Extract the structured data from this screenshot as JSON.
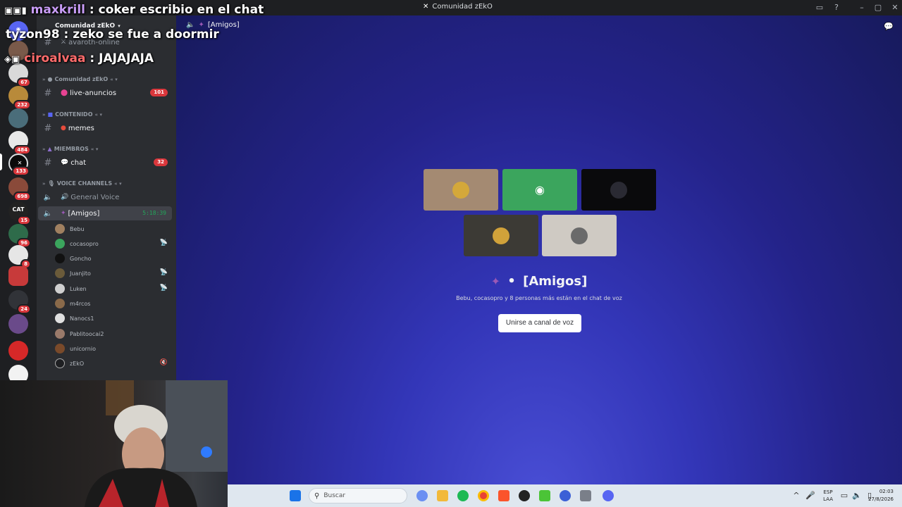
{
  "window": {
    "title": "Comunidad zEkO"
  },
  "overlay_chat": [
    {
      "user": "maxkrill",
      "message": "coker escribio en el chat",
      "color": "#c89cf6"
    },
    {
      "user": "tyzon98",
      "message": "zeko se fue a doormir",
      "color": "#ffffff"
    },
    {
      "user": "ciroalvaa",
      "message": "JAJAJAJA",
      "color": "#ff6b6b"
    }
  ],
  "rail": {
    "badges": [
      "67",
      "232",
      "484",
      "133",
      "698",
      "15",
      "96",
      "8",
      "24"
    ],
    "cat_label": "CAT"
  },
  "sidebar": {
    "server_name": "Comunidad zEkO",
    "top_channel": "avaroth-online",
    "categories": {
      "community": "Comunidad zEkO",
      "content": "CONTENIDO",
      "members": "MIEMBROS",
      "voice": "VOICE CHANNELS"
    },
    "channels": {
      "announcements": {
        "label": "live-anuncios",
        "badge": "101"
      },
      "memes": {
        "label": "memes"
      },
      "chat": {
        "label": "chat",
        "badge": "32"
      },
      "general_voice": {
        "label": "General Voice"
      },
      "amigos": {
        "label": "[Amigos]",
        "timer": "5:18:39"
      }
    },
    "voice_users": [
      "Bebu",
      "cocasopro",
      "Goncho",
      "Juanjito",
      "Luken",
      "m4rcos",
      "Nanocs1",
      "Pablitoocai2",
      "unicornio",
      "zEkO"
    ]
  },
  "main": {
    "header": "[Amigos]",
    "lobby_title": "[Amigos]",
    "lobby_subtitle": "Bebu, cocasopro y 8 personas más están en el chat de voz",
    "join_label": "Unirse a canal de voz"
  },
  "taskbar": {
    "search_placeholder": "Buscar",
    "lang_top": "ESP",
    "lang_bottom": "LAA",
    "time": "02:03",
    "date": "27/8/2026"
  },
  "colors": {
    "sidebar_bg": "#2b2d31",
    "rail_bg": "#1e1f22",
    "badge_red": "#da373c",
    "voice_green": "#23a55a",
    "discord_green": "#3ba55d",
    "lobby_blue": "#3336b8"
  },
  "icons": [
    "discord-icon",
    "hash-icon",
    "speaker-icon",
    "windows-start-icon",
    "search-icon",
    "chrome-icon",
    "spotify-icon"
  ]
}
